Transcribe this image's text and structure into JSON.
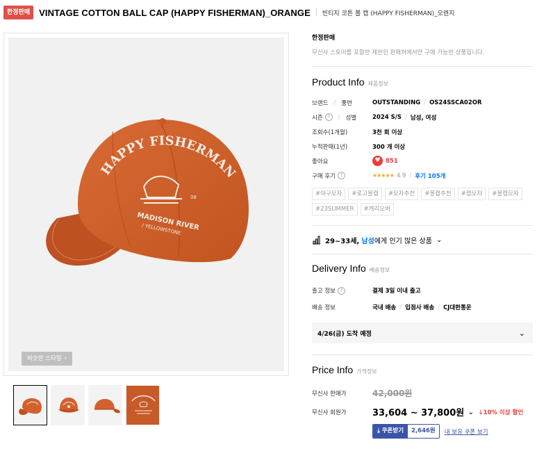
{
  "header": {
    "badge": "한정판매",
    "title": "VINTAGE COTTON BALL CAP (HAPPY FISHERMAN)_ORANGE",
    "subtitle": "빈티지 코튼 볼 캡 (HAPPY FISHERMAN)_오렌지"
  },
  "gallery": {
    "similar_style_label": "비슷한 스타일",
    "thumbnail_count": 4,
    "active_thumbnail": 1,
    "cap_color": "#d4612d",
    "embroidery_color": "#f3ede6"
  },
  "limited": {
    "heading": "한정판매",
    "description": "무신사 스토어를 포함한 제한된 판매처에서만 구매 가능한 상품입니다."
  },
  "product_info": {
    "title_en": "Product Info",
    "title_ko": "제품정보",
    "brand_label": "브랜드",
    "sku_label": "품번",
    "brand": "OUTSTANDING",
    "sku": "OS24SSCA02OR",
    "season_label": "시즌",
    "gender_label": "성별",
    "season": "2024 S/S",
    "gender": "남성, 여성",
    "views_label": "조회수(1개월)",
    "views": "3천 회 이상",
    "sales_label": "누적판매(1년)",
    "sales": "300 개 이상",
    "likes_label": "좋아요",
    "likes": "851",
    "review_label": "구매 후기",
    "rating": "4.9",
    "review_link": "후기 105개",
    "tags": [
      "#야구모자",
      "#로고볼캡",
      "#모자추천",
      "#볼캡추천",
      "#캡모자",
      "#볼캡모자",
      "#23SUMMER",
      "#캐리오버"
    ]
  },
  "popular": {
    "age": "29~33세,",
    "gender": "남성",
    "suffix": "에게 인기 많은 상품"
  },
  "delivery": {
    "title_en": "Delivery Info",
    "title_ko": "배송정보",
    "ship_label": "출고 정보",
    "ship_value": "결제 3일 이내 출고",
    "method_label": "배송 정보",
    "method_1": "국내 배송",
    "method_2": "입점사 배송",
    "method_3": "CJ대한통운",
    "arrival": "4/26(금) 도착 예정"
  },
  "price": {
    "title_en": "Price Info",
    "title_ko": "가격정보",
    "sale_label": "무신사 판매가",
    "sale_price": "42,000원",
    "member_label": "무신사 회원가",
    "member_price": "33,604 ~ 37,800원",
    "discount": "10% 이상 할인",
    "coupon_label": "쿠폰받기",
    "coupon_amount": "2,646원",
    "my_coupon_link": "내 보유 쿠폰 보기"
  }
}
